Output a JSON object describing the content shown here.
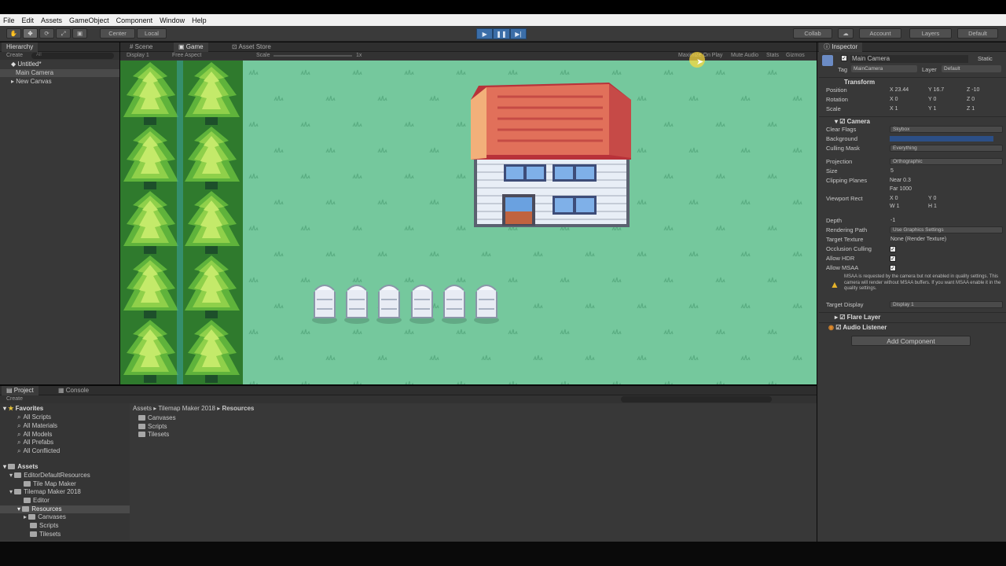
{
  "menu": [
    "File",
    "Edit",
    "Assets",
    "GameObject",
    "Component",
    "Window",
    "Help"
  ],
  "toolbar": {
    "center": "Center",
    "local": "Local",
    "collab": "Collab",
    "account": "Account",
    "layers": "Layers",
    "layout": "Default"
  },
  "hierarchy": {
    "tab": "Hierarchy",
    "create": "Create",
    "search_placeholder": "All",
    "scene": "Untitled*",
    "items": [
      "Main Camera",
      "New Canvas"
    ]
  },
  "game": {
    "tabs": [
      "Scene",
      "Game",
      "Asset Store"
    ],
    "display": "Display 1",
    "aspect": "Free Aspect",
    "scale_label": "Scale",
    "scale_value": "1x",
    "options": [
      "Maximize On Play",
      "Mute Audio",
      "Stats",
      "Gizmos"
    ]
  },
  "inspector": {
    "tab": "Inspector",
    "object_name": "Main Camera",
    "static": "Static",
    "tag_label": "Tag",
    "tag_value": "MainCamera",
    "layer_label": "Layer",
    "layer_value": "Default",
    "transform": {
      "title": "Transform",
      "position": {
        "label": "Position",
        "x": "23.44",
        "y": "16.7",
        "z": "-10"
      },
      "rotation": {
        "label": "Rotation",
        "x": "0",
        "y": "0",
        "z": "0"
      },
      "scale": {
        "label": "Scale",
        "x": "1",
        "y": "1",
        "z": "1"
      }
    },
    "camera": {
      "title": "Camera",
      "clear_flags_label": "Clear Flags",
      "clear_flags": "Skybox",
      "background_label": "Background",
      "culling_mask_label": "Culling Mask",
      "culling_mask": "Everything",
      "projection_label": "Projection",
      "projection": "Orthographic",
      "size_label": "Size",
      "size": "5",
      "clipping_label": "Clipping Planes",
      "near_label": "Near",
      "near": "0.3",
      "far_label": "Far",
      "far": "1000",
      "viewport_label": "Viewport Rect",
      "vx": "0",
      "vy": "0",
      "vw": "1",
      "vh": "1",
      "depth_label": "Depth",
      "depth": "-1",
      "rendering_path_label": "Rendering Path",
      "rendering_path": "Use Graphics Settings",
      "target_texture_label": "Target Texture",
      "target_texture": "None (Render Texture)",
      "occlusion_label": "Occlusion Culling",
      "hdr_label": "Allow HDR",
      "msaa_label": "Allow MSAA",
      "warning": "MSAA is requested by the camera but not enabled in quality settings. This camera will render without MSAA buffers. If you want MSAA enable it in the quality settings.",
      "target_display_label": "Target Display",
      "target_display": "Display 1"
    },
    "flare_layer": "Flare Layer",
    "audio_listener": "Audio Listener",
    "add_component": "Add Component"
  },
  "project": {
    "tabs": [
      "Project",
      "Console"
    ],
    "create": "Create",
    "favorites_title": "Favorites",
    "favorites": [
      "All Scripts",
      "All Materials",
      "All Models",
      "All Prefabs",
      "All Conflicted"
    ],
    "assets_title": "Assets",
    "tree": {
      "editor_default": "EditorDefaultResources",
      "tile_map_maker": "Tile Map Maker",
      "tilemap_2018": "Tilemap Maker 2018",
      "editor": "Editor",
      "resources": "Resources",
      "canvases": "Canvases",
      "scripts": "Scripts",
      "tilesets": "Tilesets"
    },
    "breadcrumb": [
      "Assets",
      "Tilemap Maker 2018",
      "Resources"
    ],
    "contents": [
      "Canvases",
      "Scripts",
      "Tilesets"
    ]
  },
  "colors": {
    "grass": "#75c89d",
    "roof": "#e1705a",
    "play_blue": "#3b6ea8",
    "bg_swatch": "#2c4f86"
  }
}
